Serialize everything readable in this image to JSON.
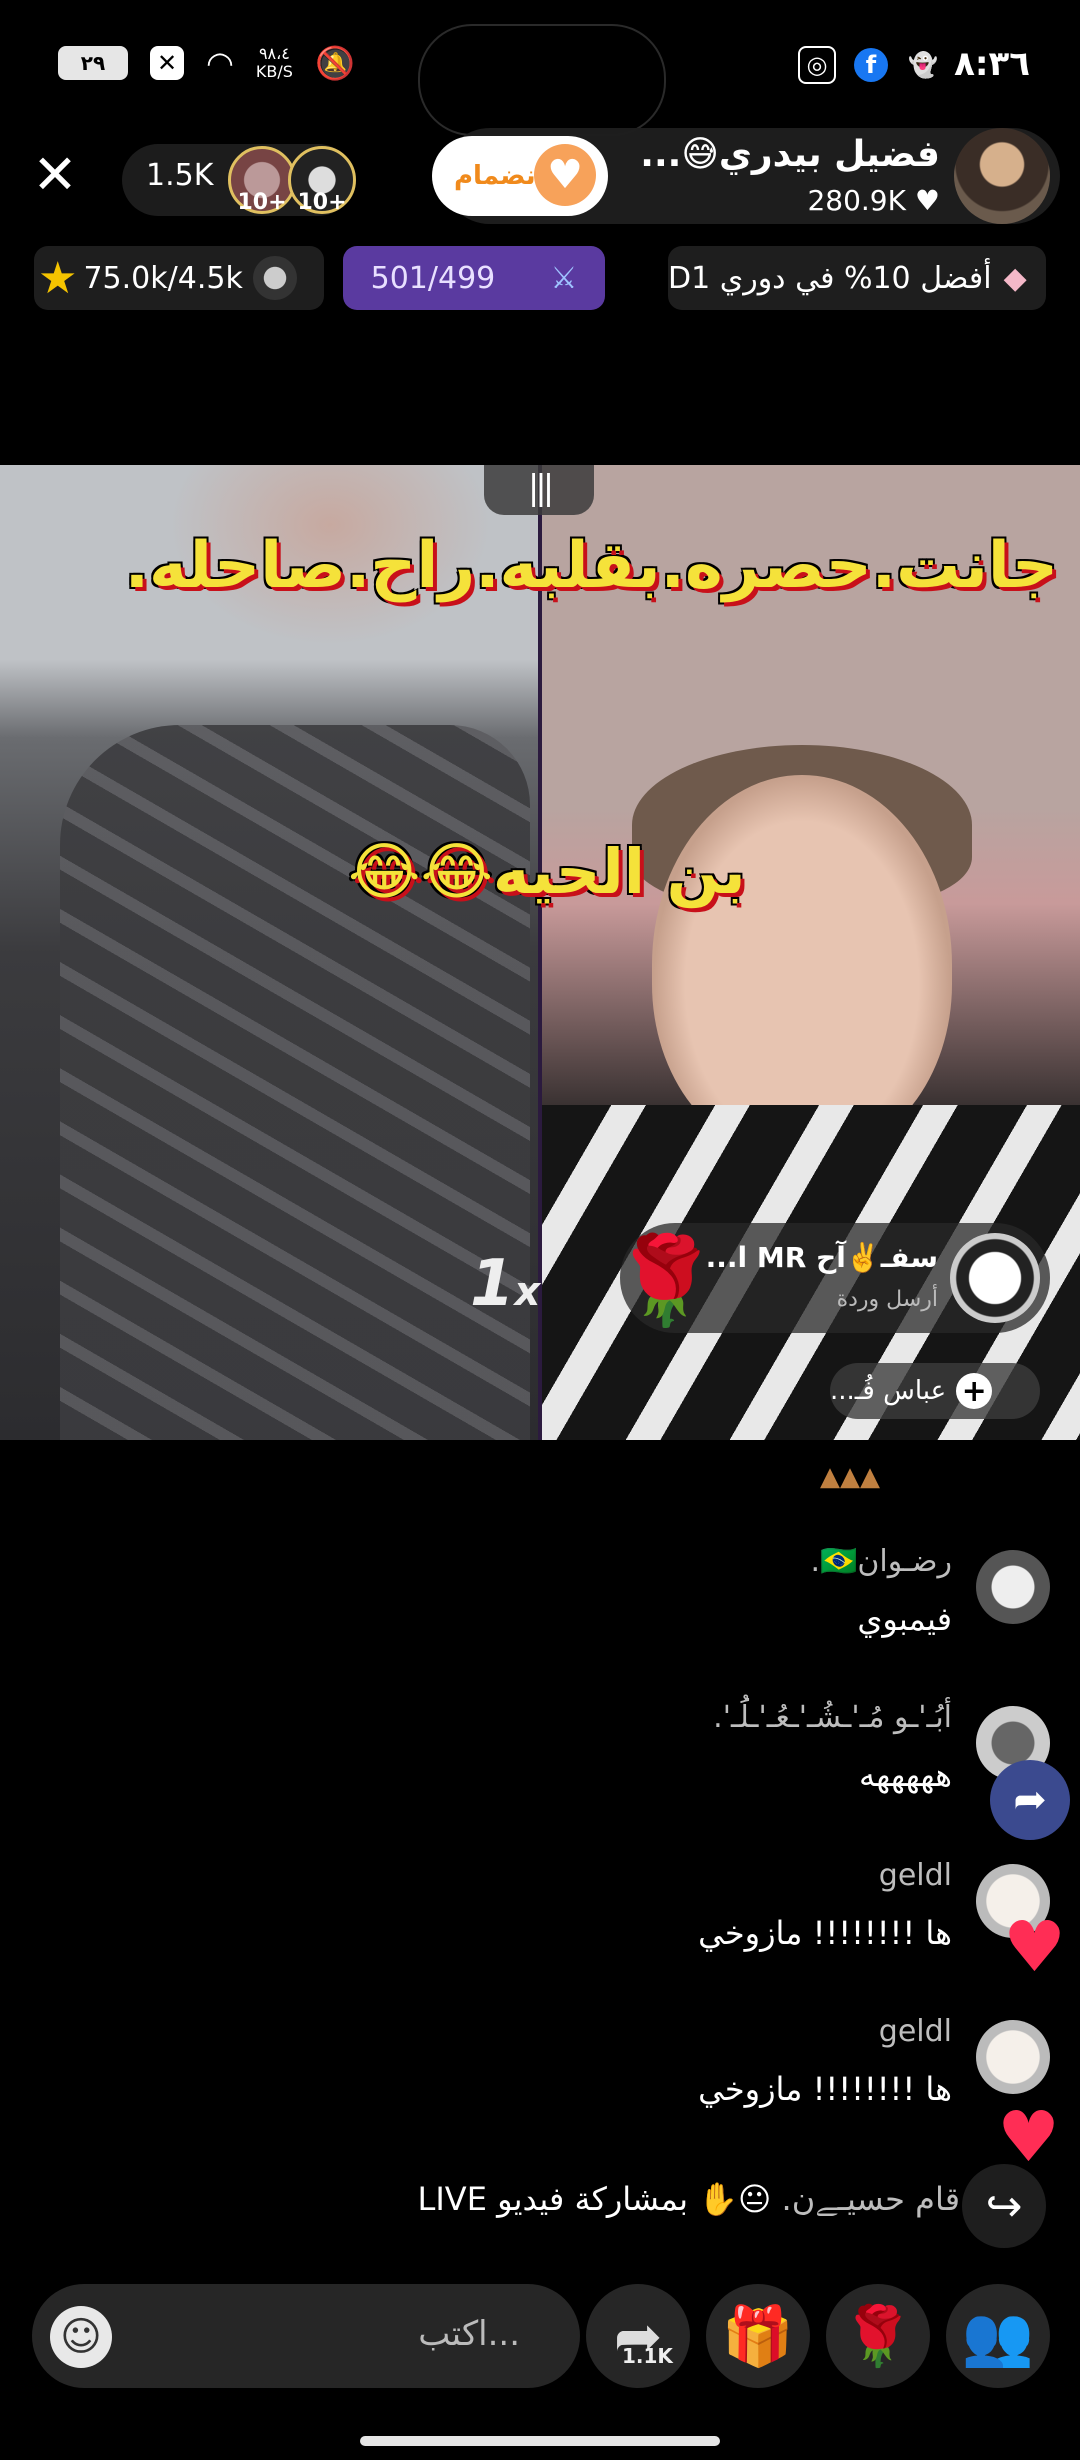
{
  "status_bar": {
    "time": "٨:٣٦",
    "network_speed": "٩٨،٤",
    "network_unit": "KB/S",
    "battery": "٢٩"
  },
  "host": {
    "name": "فضيل بيدري😅...",
    "likes": "280.9K",
    "join_label": "انضمام"
  },
  "viewers": {
    "count": "1.5K",
    "badge_1": "10+",
    "badge_2": "10+"
  },
  "chips": {
    "rank": "أفضل 10% في دوري D1",
    "score": "501/499",
    "goal": "75.0k/4.5k"
  },
  "video": {
    "caption_1": "جانت.حصره.بقلبه.راح.صاحله.",
    "caption_2": "بن الحيه😂😂",
    "speed": "1",
    "speed_suffix": "x",
    "gift_sender": "سفـ✌️آح MR ا...",
    "gift_action": "أرسل وردة",
    "follow_name": "عباس فُـ..."
  },
  "comments": [
    {
      "name": "رضـوان🇧🇷.",
      "text": "فيمبوي"
    },
    {
      "name": "أبُـ'ـو مُـ'ـشُـ'ـعُـ'ـلَُـ'.",
      "text": "هههههه"
    },
    {
      "name": "geldl",
      "text": "ها !!!!!!!! مازوخي"
    },
    {
      "name": "geldl",
      "text": "ها !!!!!!!! مازوخي"
    }
  ],
  "system_message": {
    "name": "قام حسيـﮯن.",
    "emoji": "😐✋",
    "action": "بمشاركة فيديو LIVE"
  },
  "bottom_bar": {
    "input_placeholder": "...اكتب",
    "share_count": "1.1K"
  },
  "colors": {
    "caption_yellow": "#f5e23a",
    "caption_red": "#c8101a",
    "score_chip": "#5a3aa0",
    "heart": "#ff2d55",
    "join_text": "#f08a1c"
  }
}
